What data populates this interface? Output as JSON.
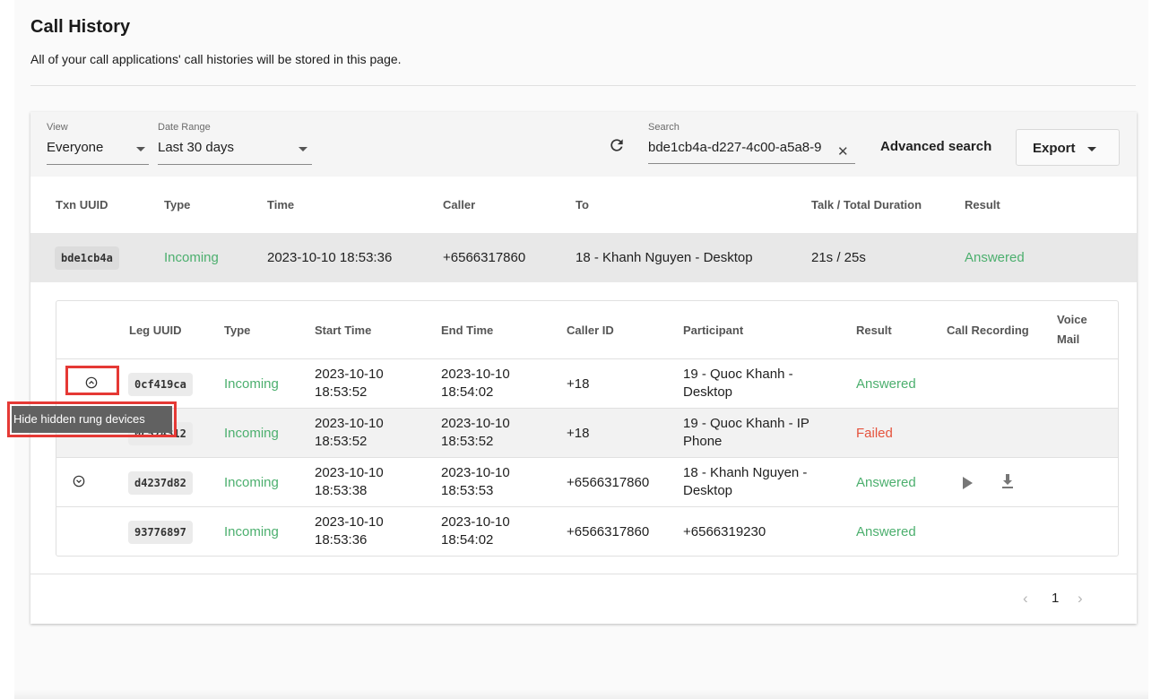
{
  "page": {
    "title": "Call History",
    "subtitle": "All of your call applications' call histories will be stored in this page."
  },
  "filters": {
    "view_label": "View",
    "view_value": "Everyone",
    "date_label": "Date Range",
    "date_value": "Last 30 days",
    "search_label": "Search",
    "search_value": "bde1cb4a-d227-4c00-a5a8-9",
    "advanced_search": "Advanced search",
    "export": "Export"
  },
  "table": {
    "headers": [
      "Txn UUID",
      "Type",
      "Time",
      "Caller",
      "To",
      "Talk / Total Duration",
      "Result"
    ],
    "row": {
      "uuid": "bde1cb4a",
      "type": "Incoming",
      "time": "2023-10-10 18:53:36",
      "caller": "+6566317860",
      "to": "18 - Khanh Nguyen  - Desktop",
      "duration": "21s / 25s",
      "result": "Answered"
    }
  },
  "legs": {
    "headers": {
      "leg_uuid": "Leg UUID",
      "type": "Type",
      "start": "Start Time",
      "end": "End Time",
      "caller_id": "Caller ID",
      "participant": "Participant",
      "result": "Result",
      "recording": "Call Recording",
      "voicemail_1": "Voice",
      "voicemail_2": "Mail"
    },
    "rows": [
      {
        "uuid": "0cf419ca",
        "type": "Incoming",
        "start_date": "2023-10-10",
        "start_time": "18:53:52",
        "end_date": "2023-10-10",
        "end_time": "18:54:02",
        "caller_id": "+18",
        "participant_1": "19 - Quoc Khanh  -",
        "participant_2": "Desktop",
        "result": "Answered"
      },
      {
        "uuid": "0c574312",
        "type": "Incoming",
        "start_date": "2023-10-10",
        "start_time": "18:53:52",
        "end_date": "2023-10-10",
        "end_time": "18:53:52",
        "caller_id": "+18",
        "participant_1": "19 - Quoc Khanh  - IP",
        "participant_2": "Phone",
        "result": "Failed"
      },
      {
        "uuid": "d4237d82",
        "type": "Incoming",
        "start_date": "2023-10-10",
        "start_time": "18:53:38",
        "end_date": "2023-10-10",
        "end_time": "18:53:53",
        "caller_id": "+6566317860",
        "participant_1": "18 - Khanh Nguyen  -",
        "participant_2": "Desktop",
        "result": "Answered"
      },
      {
        "uuid": "93776897",
        "type": "Incoming",
        "start_date": "2023-10-10",
        "start_time": "18:53:36",
        "end_date": "2023-10-10",
        "end_time": "18:54:02",
        "caller_id": "+6566317860",
        "participant_1": "+6566319230",
        "participant_2": "",
        "result": "Answered"
      }
    ]
  },
  "tooltip": "Hide hidden rung devices",
  "pagination": {
    "current": "1"
  },
  "colors": {
    "success": "#4caf6e",
    "failed": "#e5533d",
    "highlight": "#e53935"
  }
}
